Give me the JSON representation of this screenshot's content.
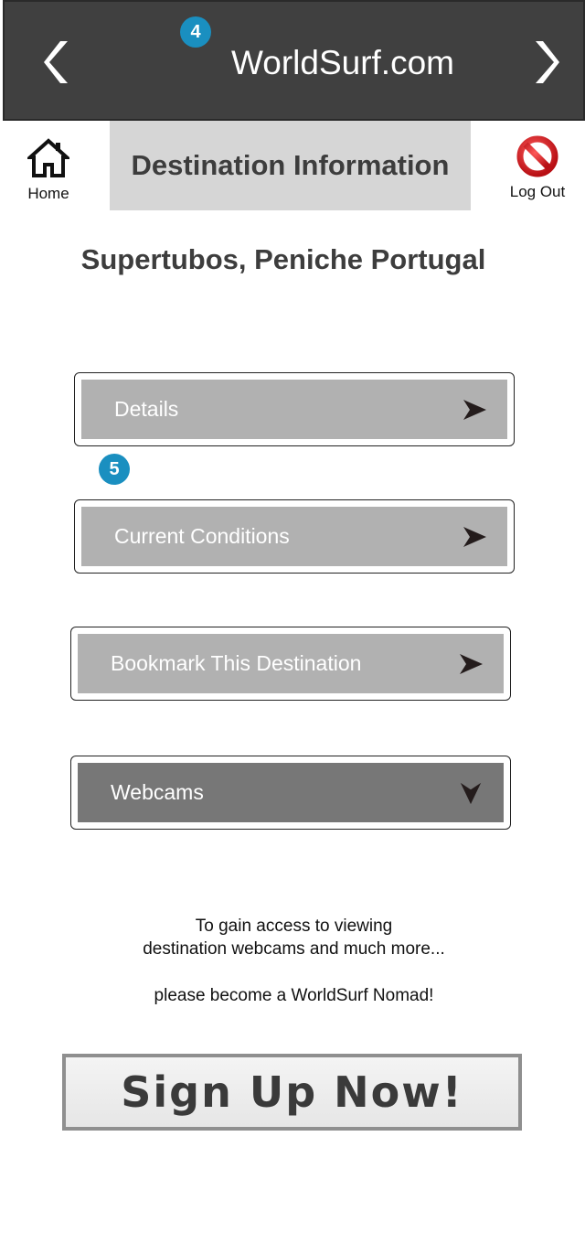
{
  "header": {
    "site_title": "WorldSurf.com",
    "back_icon": "chevron-left-icon",
    "forward_icon": "chevron-right-icon",
    "background_color": "#404040"
  },
  "annotations": {
    "badge_4": "4",
    "badge_5": "5",
    "badge_color": "#1a8fc0"
  },
  "nav": {
    "home_label": "Home",
    "home_icon": "home-icon",
    "logout_label": "Log Out",
    "logout_icon": "no-entry-icon"
  },
  "page": {
    "title": "Destination Information",
    "destination": "Supertubos, Peniche Portugal"
  },
  "menu": {
    "items": [
      {
        "label": "Details",
        "icon": "arrow-right-icon"
      },
      {
        "label": "Current Conditions",
        "icon": "arrow-right-icon"
      },
      {
        "label": "Bookmark This Destination",
        "icon": "arrow-right-icon"
      },
      {
        "label": "Webcams",
        "icon": "arrow-down-icon"
      }
    ]
  },
  "promo": {
    "line1": "To gain access to viewing",
    "line2": "destination webcams and much more...",
    "line3": "please become a WorldSurf Nomad!"
  },
  "signup": {
    "label": "Sign Up Now!"
  }
}
